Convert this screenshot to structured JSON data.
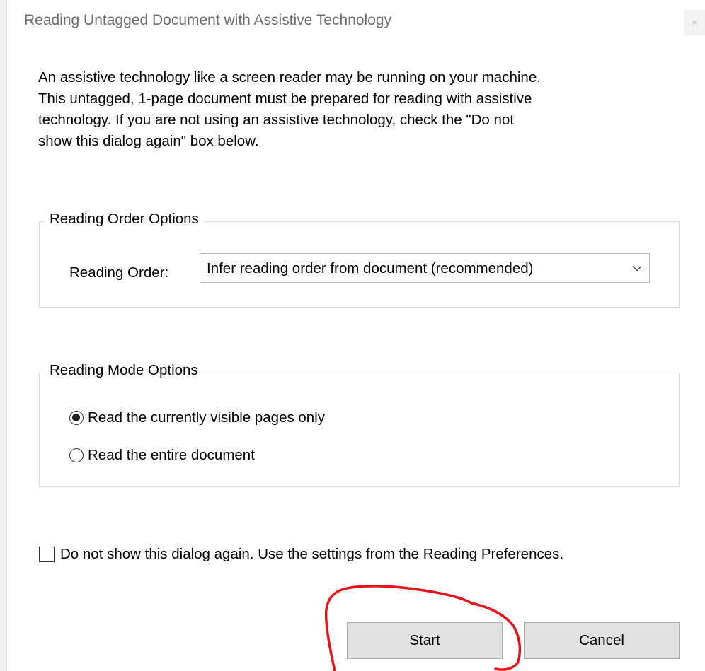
{
  "window": {
    "title": "Reading Untagged Document with Assistive Technology",
    "close_glyph": "×"
  },
  "intro_text": "An assistive technology like a screen reader may be running on your machine.\nThis untagged, 1-page document must be prepared for reading with assistive\ntechnology. If you are not using an assistive technology, check the \"Do not\nshow this dialog again\" box below.",
  "reading_order_group": {
    "legend": "Reading Order Options",
    "label": "Reading Order:",
    "selected": "Infer reading order from document (recommended)"
  },
  "reading_mode_group": {
    "legend": "Reading Mode Options",
    "options": [
      {
        "label": "Read the currently visible pages only",
        "checked": true
      },
      {
        "label": "Read the entire document",
        "checked": false
      }
    ]
  },
  "dont_show": {
    "label": "Do not show this dialog again. Use the settings from the Reading Preferences.",
    "checked": false
  },
  "buttons": {
    "start": "Start",
    "cancel": "Cancel"
  },
  "annotation_color": "#e8141b"
}
